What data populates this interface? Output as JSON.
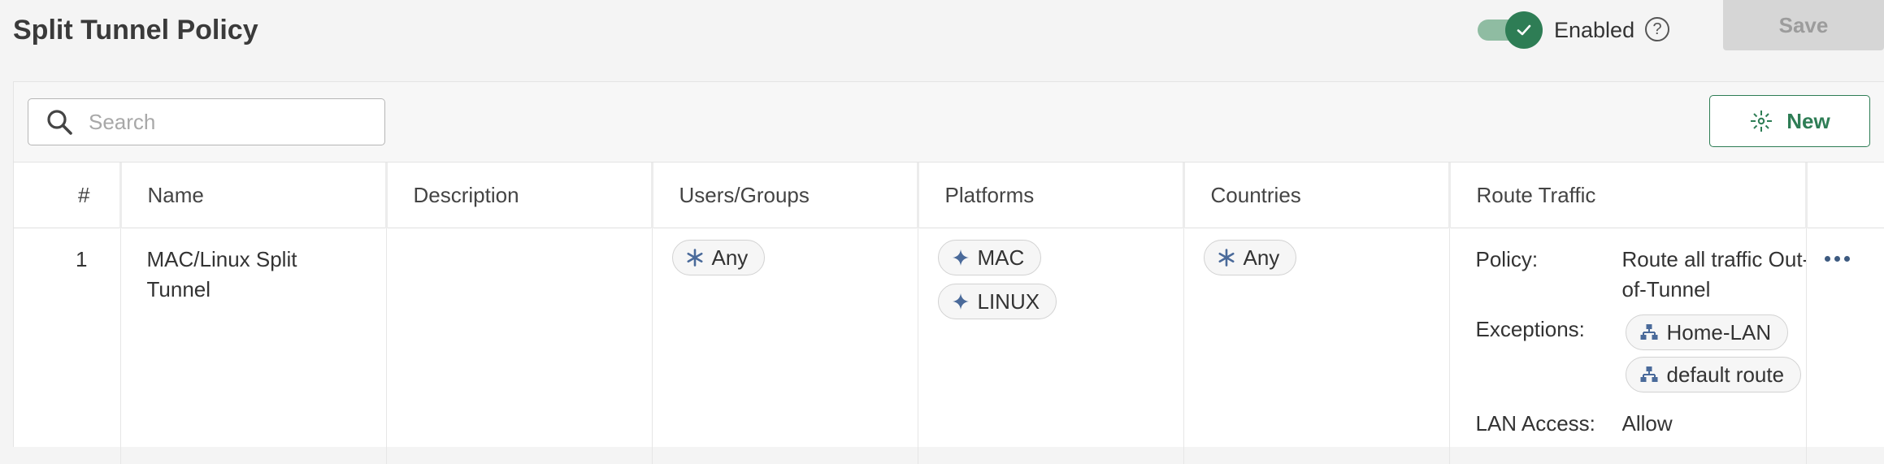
{
  "header": {
    "title": "Split Tunnel Policy",
    "toggle_label": "Enabled",
    "toggle_state": "on",
    "help_icon": "question-circle-icon",
    "save_label": "Save"
  },
  "toolbar": {
    "search_placeholder": "Search",
    "search_value": "",
    "new_label": "New"
  },
  "table": {
    "columns": [
      "#",
      "Name",
      "Description",
      "Users/Groups",
      "Platforms",
      "Countries",
      "Route Traffic",
      ""
    ],
    "rows": [
      {
        "num": "1",
        "name": "MAC/Linux Split Tunnel",
        "description": "",
        "users": [
          "Any"
        ],
        "platforms": [
          "MAC",
          "LINUX"
        ],
        "countries": [
          "Any"
        ],
        "route": {
          "policy_label": "Policy:",
          "policy_value": "Route all traffic Out-of-Tunnel",
          "exceptions_label": "Exceptions:",
          "exceptions": [
            "Home-LAN",
            "default route"
          ],
          "lan_label": "LAN Access:",
          "lan_value": "Allow"
        }
      }
    ]
  },
  "colors": {
    "accent": "#2e7d55",
    "chip_icon": "#4a6a9a",
    "save_disabled_bg": "#d6d6d6"
  }
}
